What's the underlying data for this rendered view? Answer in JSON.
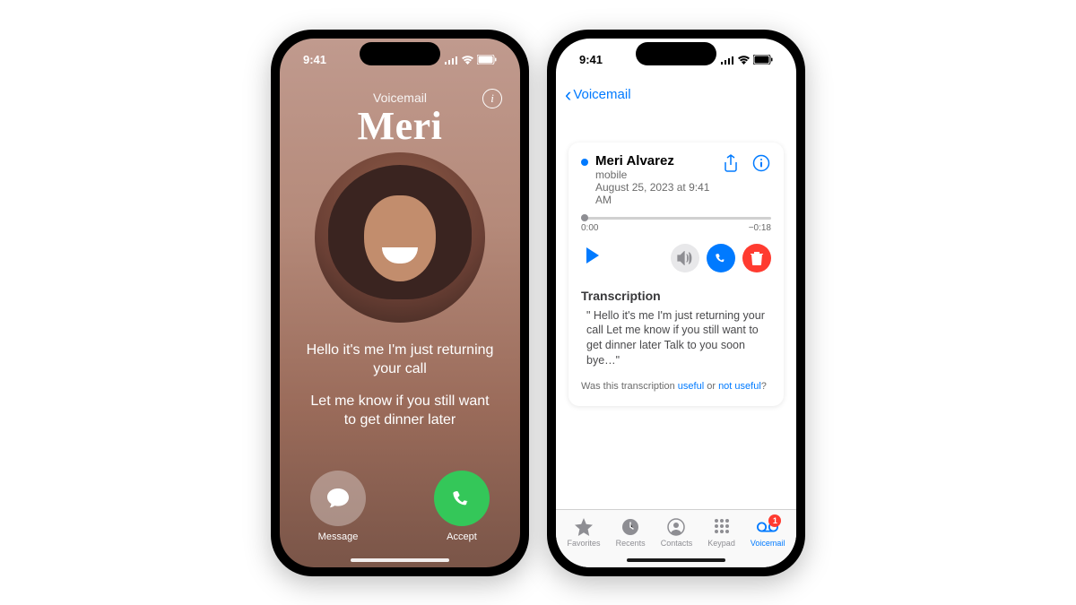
{
  "status": {
    "time": "9:41"
  },
  "phone1": {
    "label": "Voicemail",
    "caller_name": "Meri",
    "info_glyph": "i",
    "preview_line1": "Hello it's me I'm just returning your call",
    "preview_line2": "Let me know if you still want to get dinner later",
    "actions": {
      "message": "Message",
      "accept": "Accept"
    }
  },
  "phone2": {
    "back_label": "Voicemail",
    "caller": "Meri Alvarez",
    "line_type": "mobile",
    "timestamp": "August 25, 2023 at 9:41 AM",
    "elapsed": "0:00",
    "remaining": "−0:18",
    "transcription_title": "Transcription",
    "transcription_body": "\" Hello it's me I'm just returning your call Let me know if you still want to get dinner later Talk to you soon bye…\"",
    "feedback_prefix": "Was this transcription ",
    "feedback_useful": "useful",
    "feedback_or": " or ",
    "feedback_not_useful": "not useful",
    "feedback_suffix": "?",
    "tabs": {
      "favorites": "Favorites",
      "recents": "Recents",
      "contacts": "Contacts",
      "keypad": "Keypad",
      "voicemail": "Voicemail",
      "badge": "1"
    }
  }
}
